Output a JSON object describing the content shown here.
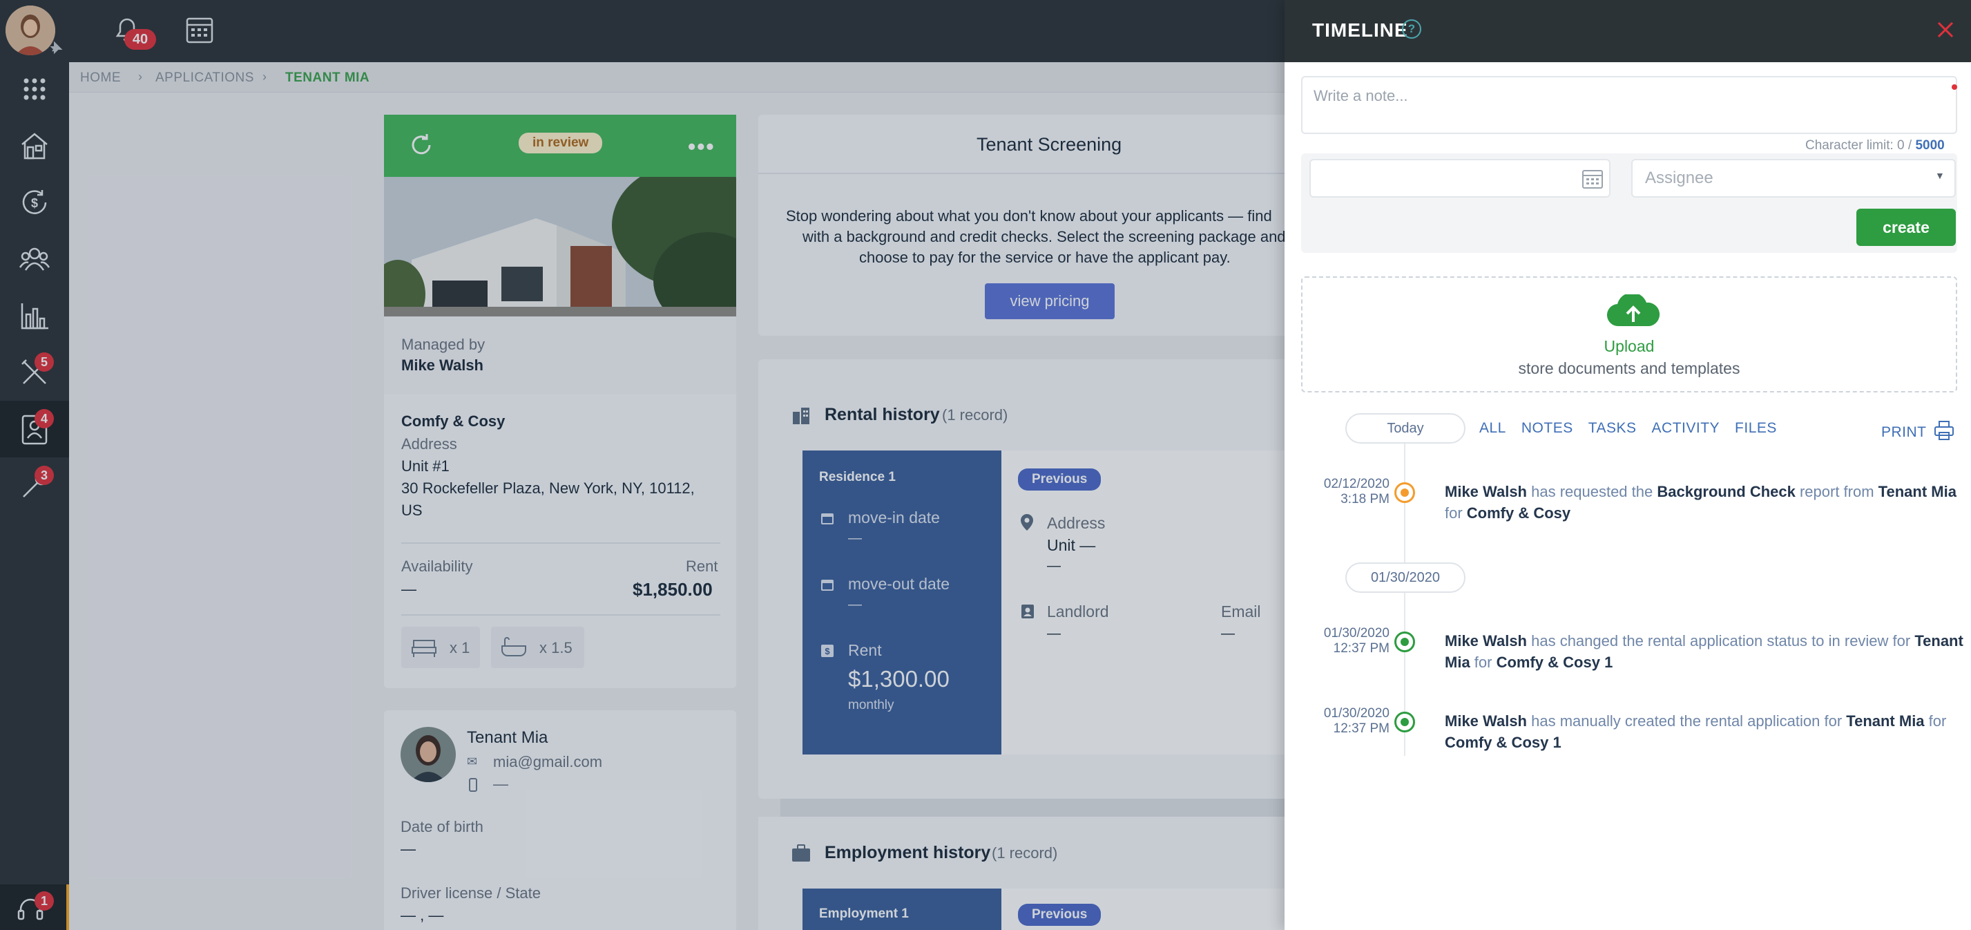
{
  "sidebar": {
    "notification_count": "40",
    "badges": {
      "maintenance": "5",
      "applications": "4",
      "tools": "3",
      "support": "1"
    }
  },
  "breadcrumb": {
    "home": "HOME",
    "applications": "APPLICATIONS",
    "current": "TENANT MIA"
  },
  "property": {
    "status": "in review",
    "managed_by_label": "Managed by",
    "manager": "Mike Walsh",
    "name": "Comfy & Cosy",
    "address_label": "Address",
    "unit": "Unit #1",
    "street": "30 Rockefeller Plaza, New York, NY, 10112,",
    "country": "US",
    "availability_label": "Availability",
    "availability": "—",
    "rent_label": "Rent",
    "rent": "$1,850.00",
    "beds": "x 1",
    "baths": "x 1.5"
  },
  "tenant": {
    "name": "Tenant Mia",
    "email": "mia@gmail.com",
    "phone": "—",
    "dob_label": "Date of birth",
    "dob": "—",
    "license_label": "Driver license / State",
    "license": "— , —"
  },
  "screening": {
    "title": "Tenant Screening",
    "line1": "Stop wondering about what you don't know about your applicants — find",
    "line2": "with a background and credit checks. Select the screening package and",
    "line3": "choose to pay for the service or have the applicant pay.",
    "button": "view pricing"
  },
  "rental_history": {
    "title": "Rental history",
    "count": "(1 record)",
    "residence": "Residence 1",
    "movein_label": "move-in date",
    "movein": "—",
    "moveout_label": "move-out date",
    "moveout": "—",
    "rent_label": "Rent",
    "rent": "$1,300.00",
    "period": "monthly",
    "tag": "Previous",
    "address_label": "Address",
    "unit": "Unit —",
    "address_value": "—",
    "landlord_label": "Landlord",
    "landlord": "—",
    "email_label": "Email",
    "email": "—"
  },
  "employment_history": {
    "title": "Employment history",
    "count": "(1 record)",
    "employment": "Employment 1",
    "tag": "Previous"
  },
  "timeline": {
    "title": "TIMELINE",
    "help": "?",
    "note_placeholder": "Write a note...",
    "char_limit_label": "Character limit: 0 /",
    "char_limit_max": "5000",
    "assignee_placeholder": "Assignee",
    "create_label": "create",
    "upload_label": "Upload",
    "upload_sub": "store documents and templates",
    "today_label": "Today",
    "filters": [
      "ALL",
      "NOTES",
      "TASKS",
      "ACTIVITY",
      "FILES"
    ],
    "print_label": "PRINT",
    "group2_label": "01/30/2020",
    "events": [
      {
        "date": "02/12/2020",
        "time": "3:18 PM",
        "color": "#f39c2d",
        "actor": "Mike Walsh",
        "t1": " has requested the ",
        "b1": "Background Check",
        "t2": " report from ",
        "b2": "Tenant Mia",
        "t3": " for ",
        "b3": "Comfy & Cosy",
        "t4": ""
      },
      {
        "date": "01/30/2020",
        "time": "12:37 PM",
        "color": "#2e9c41",
        "actor": "Mike Walsh",
        "t1": " has changed the rental application status to in review for ",
        "b1": "Tenant Mia",
        "t2": " for ",
        "b2": "Comfy & Cosy 1",
        "t3": "",
        "b3": "",
        "t4": ""
      },
      {
        "date": "01/30/2020",
        "time": "12:37 PM",
        "color": "#2e9c41",
        "actor": "Mike Walsh",
        "t1": " has manually created the rental application for ",
        "b1": "Tenant Mia",
        "t2": " for ",
        "b2": "Comfy & Cosy 1",
        "t3": "",
        "b3": "",
        "t4": ""
      }
    ]
  }
}
